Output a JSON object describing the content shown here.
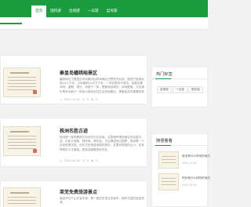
{
  "nav": {
    "items": [
      "首页",
      "国内游",
      "出境游",
      "一日游",
      "自驾游"
    ],
    "active_index": 0
  },
  "articles": [
    {
      "title": "秦皇岛蟠桃峪景区",
      "body": "蟠桃峪位于秦皇岛市北戴河区和海港区交界的东北部，距抚宁县城北部18.5千米，占地面积24平方千米，一年四季均可游览，该景区集休闲、度假、观光、科普于一体，是集旅游观光、休闲度假、文化娱乐等多功能于一体的大型综合性生态旅游景区，是秦皇岛市重要的旅游景区之一。",
      "date": "2021-10-30",
      "comments": "0",
      "views": "5"
    },
    {
      "title": "株洲名胜古迹",
      "body": "株洲是一座有着悠久历史的文化名城，这里拥有很多著名的名胜古迹，比如炎帝陵、神农城、神农谷、白石港湿地公园等，株洲是一个自然资源丰富、历史文化底蕴深厚的城市。这里有秀丽的山川，也有神奇的人文景观，是旅游度假的好去处。",
      "date": "2021-10-30",
      "comments": "0",
      "views": "5"
    },
    {
      "title": "莱芜免费旅游景点",
      "body": "莱芜市位于山东省中部，是一座历史悠久的城市，拥有丰富的旅游资源。"
    }
  ],
  "sidebar": {
    "hot_title": "热门标签",
    "tags": [
      "自驾游",
      "一日游",
      "国内游"
    ],
    "recommend_title": "随便看看",
    "recommend_items": [
      {
        "title": "临沧有什么好玩的地方",
        "date": "2021-10-30"
      },
      {
        "title": "怀化有什么好玩的地方",
        "date": "2021-10-30"
      }
    ]
  },
  "colors": {
    "primary": "#1a9c3f",
    "background": "#f2f2f2"
  }
}
